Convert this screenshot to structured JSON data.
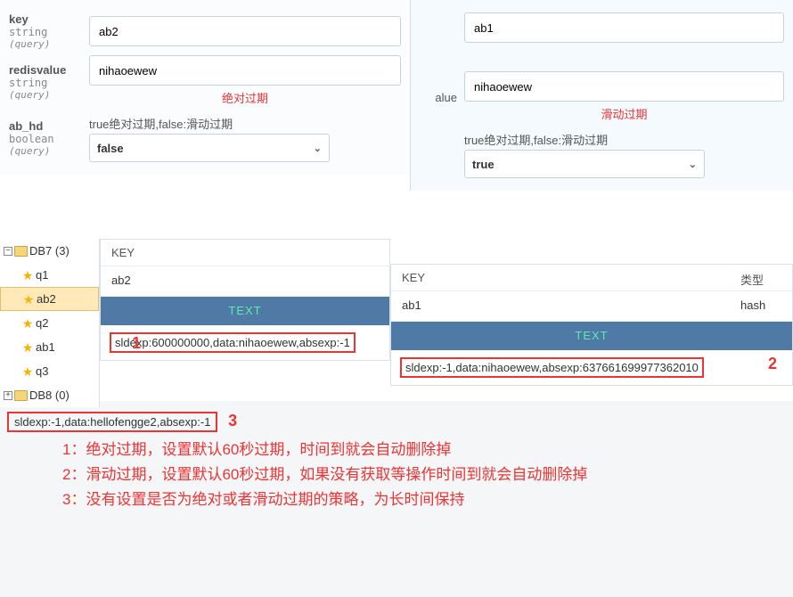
{
  "left_form": {
    "key": {
      "label": "key",
      "type": "string",
      "source": "(query)",
      "value": "ab2"
    },
    "redisvalue": {
      "label": "redisvalue",
      "type": "string",
      "source": "(query)",
      "value": "nihaoewew"
    },
    "note_red": "绝对过期",
    "ab_hd": {
      "label": "ab_hd",
      "type": "boolean",
      "source": "(query)",
      "help": "true绝对过期,false:滑动过期",
      "value": "false"
    }
  },
  "right_form": {
    "key_value": "ab1",
    "value_label": "alue",
    "value_value": "nihaoewew",
    "note_red": "滑动过期",
    "help": "true绝对过期,false:滑动过期",
    "select_value": "true"
  },
  "tree": {
    "db7": {
      "label": "DB7 (3)",
      "expanded": true
    },
    "items": [
      "q1",
      "ab2",
      "q2",
      "ab1",
      "q3"
    ],
    "selected": "ab2",
    "db8": {
      "label": "DB8 (0)",
      "expanded": false
    }
  },
  "key_panel_left": {
    "header": {
      "key": "KEY"
    },
    "row": {
      "key": "ab2"
    },
    "text_label": "TEXT",
    "data": "sldexp:600000000,data:nihaoewew,absexp:-1",
    "marker": "1"
  },
  "key_panel_right": {
    "header": {
      "key": "KEY",
      "type": "类型"
    },
    "row": {
      "key": "ab1",
      "type": "hash"
    },
    "text_label": "TEXT",
    "data": "sldexp:-1,data:nihaoewew,absexp:637661699977362010",
    "marker": "2"
  },
  "bottom": {
    "data": "sldexp:-1,data:hellofengge2,absexp:-1",
    "marker": "3",
    "explains": [
      "1：绝对过期，设置默认60秒过期，时间到就会自动删除掉",
      "2：滑动过期，设置默认60秒过期，如果没有获取等操作时间到就会自动删除掉",
      "3：没有设置是否为绝对或者滑动过期的策略，为长时间保持"
    ]
  }
}
